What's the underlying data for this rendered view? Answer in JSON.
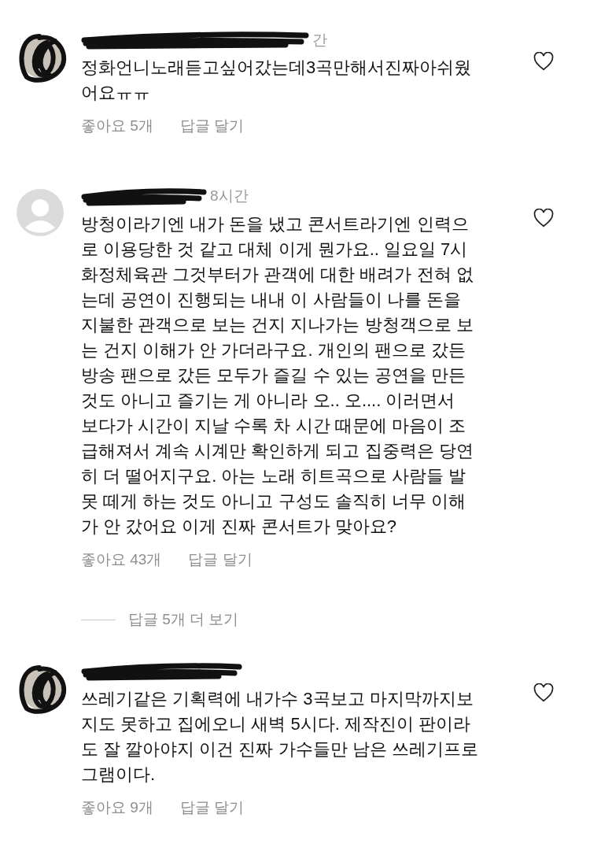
{
  "comments": [
    {
      "avatar": {
        "kind": "scribbled"
      },
      "time": "간",
      "lines": [
        "정화언니노래듣고싶어갔는데3곡만해서진짜아쉬웠",
        "어요ㅠㅠ"
      ],
      "likes": "좋아요 5개",
      "reply": "답글 달기",
      "liked": false
    },
    {
      "avatar": {
        "kind": "default"
      },
      "time": "8시간",
      "lines": [
        "방청이라기엔 내가 돈을 냈고 콘서트라기엔 인력으",
        "로 이용당한 것 같고 대체 이게 뭔가요.. 일요일 7시",
        "화정체육관 그것부터가 관객에 대한 배려가 전혀 없",
        "는데 공연이 진행되는 내내 이 사람들이 나를 돈을",
        "지불한 관객으로 보는 건지 지나가는 방청객으로 보",
        "는 건지 이해가 안 가더라구요. 개인의 팬으로 갔든",
        "방송 팬으로 갔든 모두가 즐길 수 있는 공연을 만든",
        "것도 아니고 즐기는 게 아니라 오.. 오.... 이러면서",
        "보다가 시간이 지날 수록 차 시간 때문에 마음이 조",
        "급해져서 계속 시계만 확인하게 되고 집중력은 당연",
        "히 더 떨어지구요. 아는 노래 히트곡으로 사람들 발",
        "못 떼게 하는 것도 아니고 구성도 솔직히 너무 이해",
        "가 안 갔어요 이게 진짜 콘서트가 맞아요?"
      ],
      "likes": "좋아요 43개",
      "reply": "답글 달기",
      "liked": false,
      "more_replies": "답글 5개 더 보기"
    },
    {
      "avatar": {
        "kind": "scribbled"
      },
      "lines": [
        "쓰레기같은 기획력에 내가수 3곡보고 마지막까지보",
        "지도 못하고 집에오니 새벽 5시다. 제작진이 판이라",
        "도 잘 깔아야지 이건 진짜 가수들만 남은 쓰레기프로",
        "그램이다."
      ],
      "likes": "좋아요 9개",
      "reply": "답글 달기",
      "liked": false
    }
  ]
}
